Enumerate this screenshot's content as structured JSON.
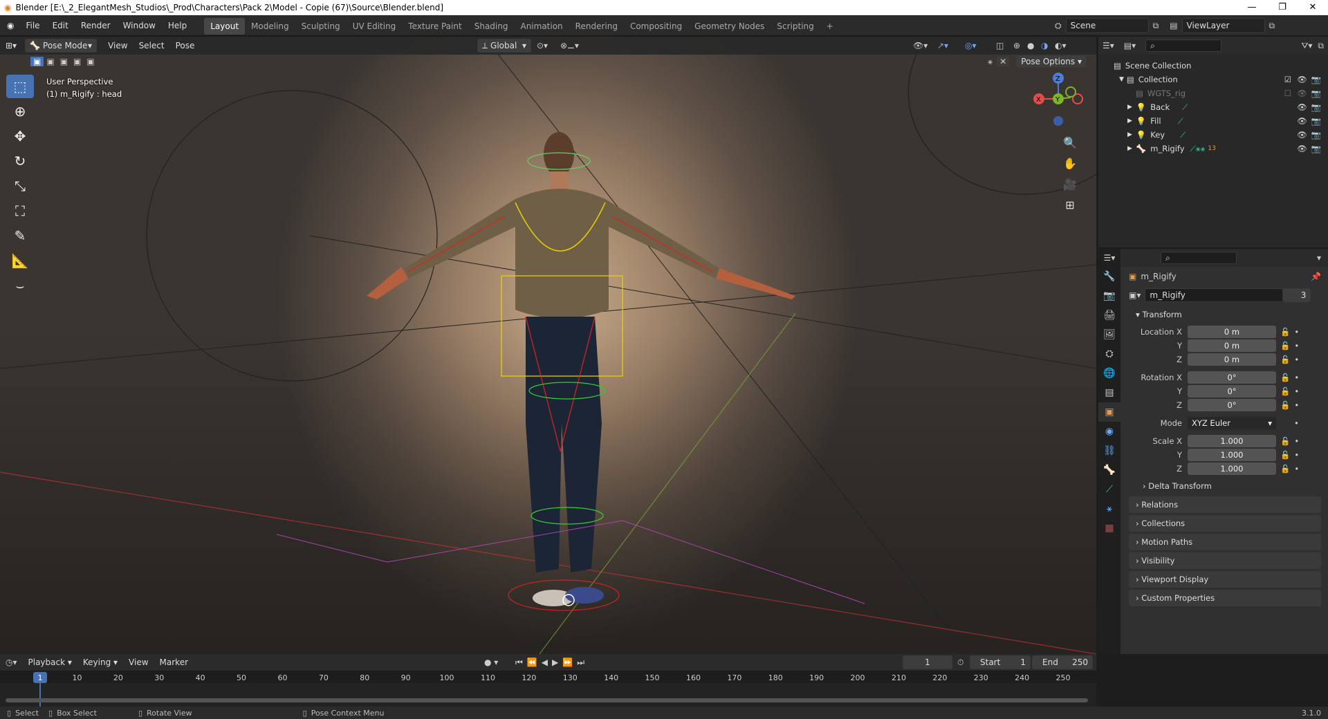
{
  "title": "Blender [E:\\_2_ElegantMesh_Studios\\_Prod\\Characters\\Pack 2\\Model - Copie (67)\\Source\\Blender.blend]",
  "window_controls": [
    "—",
    "❐",
    "✕"
  ],
  "menu": [
    "File",
    "Edit",
    "Render",
    "Window",
    "Help"
  ],
  "workspaces": [
    "Layout",
    "Modeling",
    "Sculpting",
    "UV Editing",
    "Texture Paint",
    "Shading",
    "Animation",
    "Rendering",
    "Compositing",
    "Geometry Nodes",
    "Scripting"
  ],
  "add_workspace": "+",
  "scene": "Scene",
  "viewlayer": "ViewLayer",
  "viewport": {
    "mode": "Pose Mode",
    "menus": [
      "View",
      "Select",
      "Pose"
    ],
    "transform_orientation": "Global",
    "pose_options": "Pose Options",
    "overlay_title": "User Perspective",
    "overlay_subtitle": "(1) m_Rigify : head",
    "gizmo": {
      "z": "Z",
      "y": "Y",
      "x": "X"
    }
  },
  "outliner": {
    "root": "Scene Collection",
    "collection": "Collection",
    "items": [
      {
        "name": "WGTS_rig",
        "dim": true
      },
      {
        "name": "Back"
      },
      {
        "name": "Fill"
      },
      {
        "name": "Key"
      },
      {
        "name": "m_Rigify"
      }
    ],
    "m_rigify_count": "13"
  },
  "properties": {
    "object_name": "m_Rigify",
    "data_name": "m_Rigify",
    "users": "3",
    "transform_label": "Transform",
    "location": {
      "label": "Location X",
      "x": "0 m",
      "y": "0 m",
      "z": "0 m"
    },
    "rotation": {
      "label": "Rotation X",
      "x": "0°",
      "y": "0°",
      "z": "0°"
    },
    "mode_label": "Mode",
    "mode_value": "XYZ Euler",
    "scale": {
      "label": "Scale X",
      "x": "1.000",
      "y": "1.000",
      "z": "1.000"
    },
    "axis": {
      "y": "Y",
      "z": "Z"
    },
    "delta": "Delta Transform",
    "panels": [
      "Relations",
      "Collections",
      "Motion Paths",
      "Visibility",
      "Viewport Display",
      "Custom Properties"
    ]
  },
  "timeline": {
    "menus": [
      "Playback",
      "Keying",
      "View",
      "Marker"
    ],
    "current_frame": "1",
    "start_label": "Start",
    "start": "1",
    "end_label": "End",
    "end": "250",
    "ticks": [
      "1",
      "10",
      "20",
      "30",
      "40",
      "50",
      "60",
      "70",
      "80",
      "90",
      "100",
      "110",
      "120",
      "130",
      "140",
      "150",
      "160",
      "170",
      "180",
      "190",
      "200",
      "210",
      "220",
      "230",
      "240",
      "250"
    ]
  },
  "status": {
    "select": "Select",
    "box_select": "Box Select",
    "rotate": "Rotate View",
    "context": "Pose Context Menu",
    "version": "3.1.0"
  }
}
